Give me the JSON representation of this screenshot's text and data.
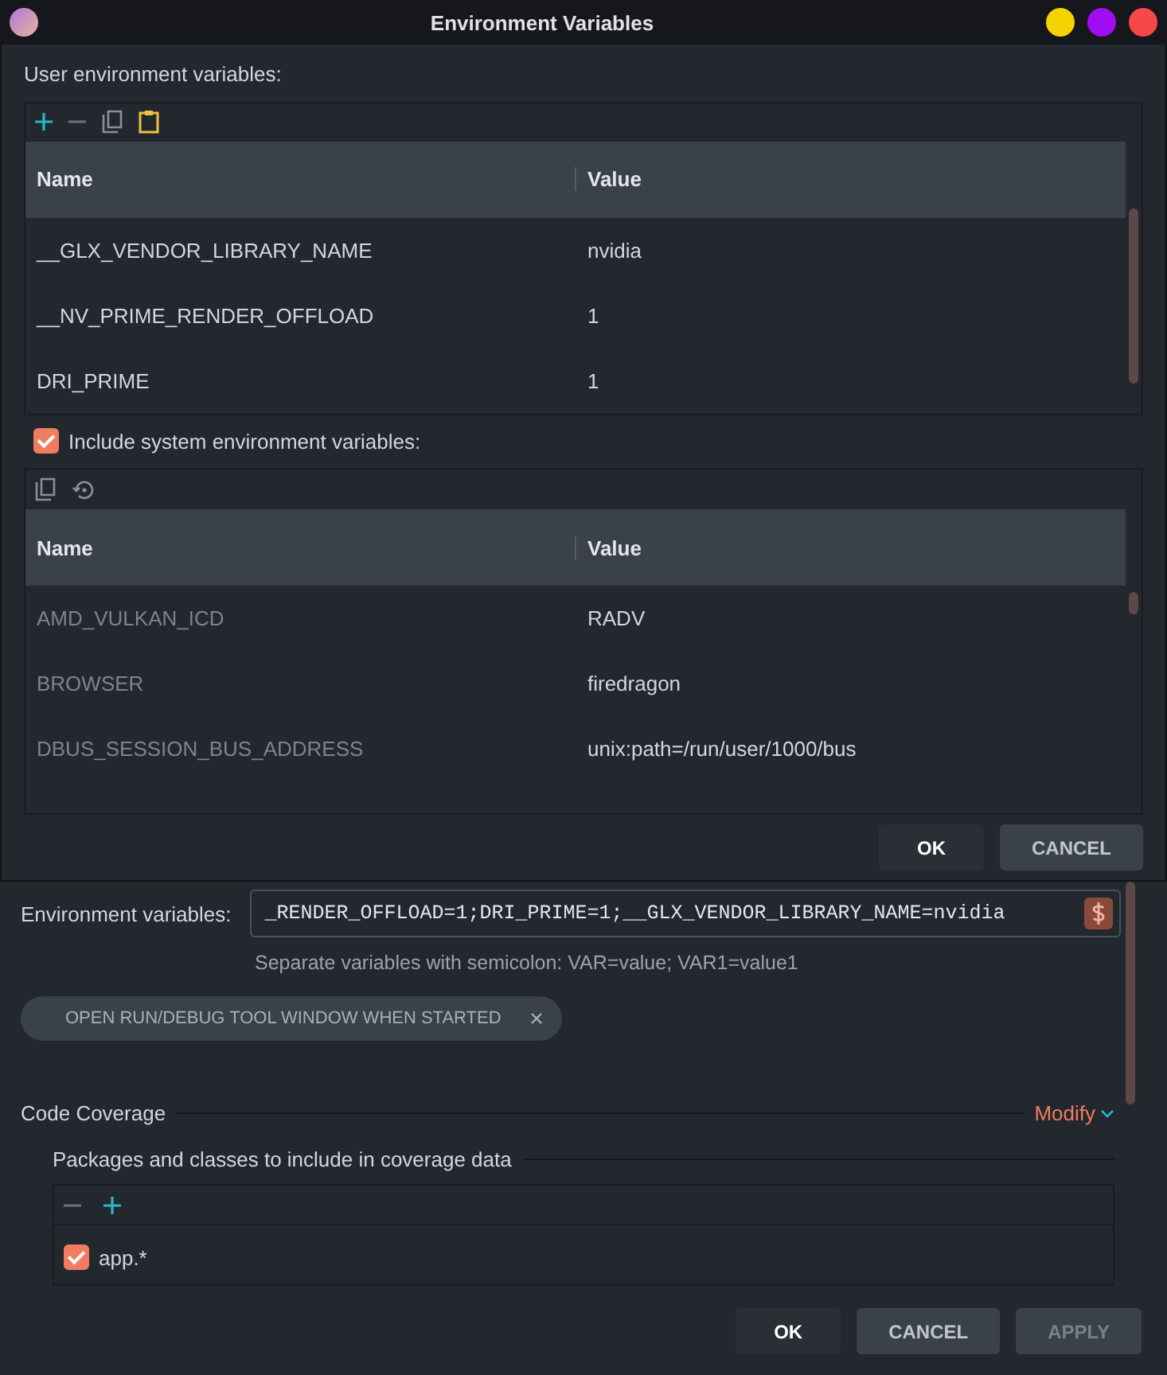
{
  "window": {
    "title": "Environment Variables"
  },
  "user_variables": {
    "label": "User environment variables:",
    "readonly": false,
    "columns": [
      "Name",
      "Value"
    ],
    "rows": [
      {
        "name": "__GLX_VENDOR_LIBRARY_NAME",
        "value": "nvidia"
      },
      {
        "name": "__NV_PRIME_RENDER_OFFLOAD",
        "value": "1"
      },
      {
        "name": "DRI_PRIME",
        "value": "1"
      }
    ]
  },
  "include_system": {
    "label": "Include system environment variables:",
    "checked": true
  },
  "system_variables": {
    "readonly": true,
    "columns": [
      "Name",
      "Value"
    ],
    "rows": [
      {
        "name": "AMD_VULKAN_ICD",
        "value": "RADV"
      },
      {
        "name": "BROWSER",
        "value": "firedragon"
      },
      {
        "name": "DBUS_SESSION_BUS_ADDRESS",
        "value": "unix:path=/run/user/1000/bus"
      }
    ]
  },
  "dialog_buttons": [
    {
      "label": "OK",
      "kind": "default"
    },
    {
      "label": "CANCEL",
      "kind": "normal"
    }
  ],
  "settings": {
    "env_label": "Environment variables:",
    "env_value": "_RENDER_OFFLOAD=1;DRI_PRIME=1;__GLX_VENDOR_LIBRARY_NAME=nvidia",
    "hint": "Separate variables with semicolon: VAR=value; VAR1=value1",
    "chip": "OPEN RUN/DEBUG TOOL WINDOW WHEN STARTED",
    "coverage": {
      "title": "Code Coverage",
      "modify": "Modify",
      "packages_label": "Packages and classes to include in coverage data",
      "patterns": [
        {
          "pattern": "app.*",
          "checked": true
        }
      ]
    },
    "buttons": [
      {
        "label": "OK",
        "kind": "default"
      },
      {
        "label": "CANCEL",
        "kind": "normal"
      },
      {
        "label": "APPLY",
        "kind": "disabled"
      }
    ]
  }
}
